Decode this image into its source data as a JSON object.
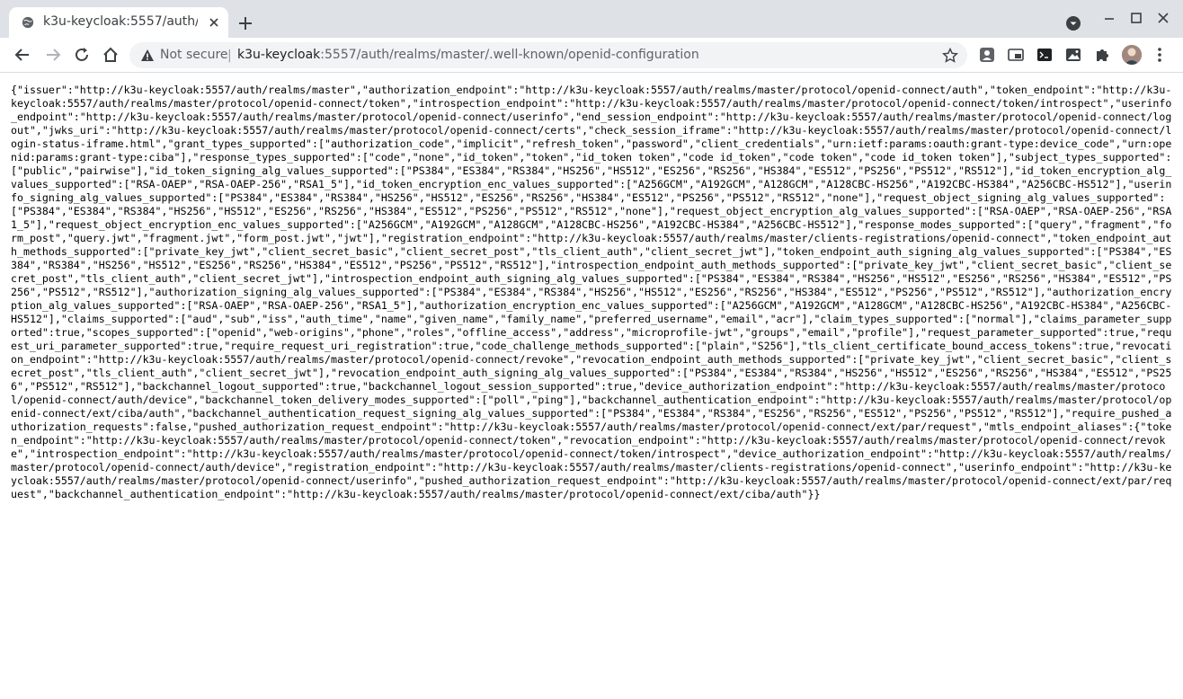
{
  "tab": {
    "title": "k3u-keycloak:5557/auth/r"
  },
  "omnibox": {
    "security_label": "Not secure",
    "separator": "|",
    "url_host": "k3u-keycloak",
    "url_rest": ":5557/auth/realms/master/.well-known/openid-configuration"
  },
  "icons": {
    "favicon": "globe-icon",
    "close": "close-icon",
    "new_tab": "plus-icon",
    "tab_search": "chevron-down-icon",
    "back": "back-arrow-icon",
    "forward": "forward-arrow-icon",
    "reload": "reload-icon",
    "home": "home-icon",
    "warning": "warning-icon",
    "bookmark": "star-icon",
    "menu": "kebab-menu-icon"
  },
  "content": {
    "text": "{\"issuer\":\"http://k3u-keycloak:5557/auth/realms/master\",\"authorization_endpoint\":\"http://k3u-keycloak:5557/auth/realms/master/protocol/openid-connect/auth\",\"token_endpoint\":\"http://k3u-keycloak:5557/auth/realms/master/protocol/openid-connect/token\",\"introspection_endpoint\":\"http://k3u-keycloak:5557/auth/realms/master/protocol/openid-connect/token/introspect\",\"userinfo_endpoint\":\"http://k3u-keycloak:5557/auth/realms/master/protocol/openid-connect/userinfo\",\"end_session_endpoint\":\"http://k3u-keycloak:5557/auth/realms/master/protocol/openid-connect/logout\",\"jwks_uri\":\"http://k3u-keycloak:5557/auth/realms/master/protocol/openid-connect/certs\",\"check_session_iframe\":\"http://k3u-keycloak:5557/auth/realms/master/protocol/openid-connect/login-status-iframe.html\",\"grant_types_supported\":[\"authorization_code\",\"implicit\",\"refresh_token\",\"password\",\"client_credentials\",\"urn:ietf:params:oauth:grant-type:device_code\",\"urn:openid:params:grant-type:ciba\"],\"response_types_supported\":[\"code\",\"none\",\"id_token\",\"token\",\"id_token token\",\"code id_token\",\"code token\",\"code id_token token\"],\"subject_types_supported\":[\"public\",\"pairwise\"],\"id_token_signing_alg_values_supported\":[\"PS384\",\"ES384\",\"RS384\",\"HS256\",\"HS512\",\"ES256\",\"RS256\",\"HS384\",\"ES512\",\"PS256\",\"PS512\",\"RS512\"],\"id_token_encryption_alg_values_supported\":[\"RSA-OAEP\",\"RSA-OAEP-256\",\"RSA1_5\"],\"id_token_encryption_enc_values_supported\":[\"A256GCM\",\"A192GCM\",\"A128GCM\",\"A128CBC-HS256\",\"A192CBC-HS384\",\"A256CBC-HS512\"],\"userinfo_signing_alg_values_supported\":[\"PS384\",\"ES384\",\"RS384\",\"HS256\",\"HS512\",\"ES256\",\"RS256\",\"HS384\",\"ES512\",\"PS256\",\"PS512\",\"RS512\",\"none\"],\"request_object_signing_alg_values_supported\":[\"PS384\",\"ES384\",\"RS384\",\"HS256\",\"HS512\",\"ES256\",\"RS256\",\"HS384\",\"ES512\",\"PS256\",\"PS512\",\"RS512\",\"none\"],\"request_object_encryption_alg_values_supported\":[\"RSA-OAEP\",\"RSA-OAEP-256\",\"RSA1_5\"],\"request_object_encryption_enc_values_supported\":[\"A256GCM\",\"A192GCM\",\"A128GCM\",\"A128CBC-HS256\",\"A192CBC-HS384\",\"A256CBC-HS512\"],\"response_modes_supported\":[\"query\",\"fragment\",\"form_post\",\"query.jwt\",\"fragment.jwt\",\"form_post.jwt\",\"jwt\"],\"registration_endpoint\":\"http://k3u-keycloak:5557/auth/realms/master/clients-registrations/openid-connect\",\"token_endpoint_auth_methods_supported\":[\"private_key_jwt\",\"client_secret_basic\",\"client_secret_post\",\"tls_client_auth\",\"client_secret_jwt\"],\"token_endpoint_auth_signing_alg_values_supported\":[\"PS384\",\"ES384\",\"RS384\",\"HS256\",\"HS512\",\"ES256\",\"RS256\",\"HS384\",\"ES512\",\"PS256\",\"PS512\",\"RS512\"],\"introspection_endpoint_auth_methods_supported\":[\"private_key_jwt\",\"client_secret_basic\",\"client_secret_post\",\"tls_client_auth\",\"client_secret_jwt\"],\"introspection_endpoint_auth_signing_alg_values_supported\":[\"PS384\",\"ES384\",\"RS384\",\"HS256\",\"HS512\",\"ES256\",\"RS256\",\"HS384\",\"ES512\",\"PS256\",\"PS512\",\"RS512\"],\"authorization_signing_alg_values_supported\":[\"PS384\",\"ES384\",\"RS384\",\"HS256\",\"HS512\",\"ES256\",\"RS256\",\"HS384\",\"ES512\",\"PS256\",\"PS512\",\"RS512\"],\"authorization_encryption_alg_values_supported\":[\"RSA-OAEP\",\"RSA-OAEP-256\",\"RSA1_5\"],\"authorization_encryption_enc_values_supported\":[\"A256GCM\",\"A192GCM\",\"A128GCM\",\"A128CBC-HS256\",\"A192CBC-HS384\",\"A256CBC-HS512\"],\"claims_supported\":[\"aud\",\"sub\",\"iss\",\"auth_time\",\"name\",\"given_name\",\"family_name\",\"preferred_username\",\"email\",\"acr\"],\"claim_types_supported\":[\"normal\"],\"claims_parameter_supported\":true,\"scopes_supported\":[\"openid\",\"web-origins\",\"phone\",\"roles\",\"offline_access\",\"address\",\"microprofile-jwt\",\"groups\",\"email\",\"profile\"],\"request_parameter_supported\":true,\"request_uri_parameter_supported\":true,\"require_request_uri_registration\":true,\"code_challenge_methods_supported\":[\"plain\",\"S256\"],\"tls_client_certificate_bound_access_tokens\":true,\"revocation_endpoint\":\"http://k3u-keycloak:5557/auth/realms/master/protocol/openid-connect/revoke\",\"revocation_endpoint_auth_methods_supported\":[\"private_key_jwt\",\"client_secret_basic\",\"client_secret_post\",\"tls_client_auth\",\"client_secret_jwt\"],\"revocation_endpoint_auth_signing_alg_values_supported\":[\"PS384\",\"ES384\",\"RS384\",\"HS256\",\"HS512\",\"ES256\",\"RS256\",\"HS384\",\"ES512\",\"PS256\",\"PS512\",\"RS512\"],\"backchannel_logout_supported\":true,\"backchannel_logout_session_supported\":true,\"device_authorization_endpoint\":\"http://k3u-keycloak:5557/auth/realms/master/protocol/openid-connect/auth/device\",\"backchannel_token_delivery_modes_supported\":[\"poll\",\"ping\"],\"backchannel_authentication_endpoint\":\"http://k3u-keycloak:5557/auth/realms/master/protocol/openid-connect/ext/ciba/auth\",\"backchannel_authentication_request_signing_alg_values_supported\":[\"PS384\",\"ES384\",\"RS384\",\"ES256\",\"RS256\",\"ES512\",\"PS256\",\"PS512\",\"RS512\"],\"require_pushed_authorization_requests\":false,\"pushed_authorization_request_endpoint\":\"http://k3u-keycloak:5557/auth/realms/master/protocol/openid-connect/ext/par/request\",\"mtls_endpoint_aliases\":{\"token_endpoint\":\"http://k3u-keycloak:5557/auth/realms/master/protocol/openid-connect/token\",\"revocation_endpoint\":\"http://k3u-keycloak:5557/auth/realms/master/protocol/openid-connect/revoke\",\"introspection_endpoint\":\"http://k3u-keycloak:5557/auth/realms/master/protocol/openid-connect/token/introspect\",\"device_authorization_endpoint\":\"http://k3u-keycloak:5557/auth/realms/master/protocol/openid-connect/auth/device\",\"registration_endpoint\":\"http://k3u-keycloak:5557/auth/realms/master/clients-registrations/openid-connect\",\"userinfo_endpoint\":\"http://k3u-keycloak:5557/auth/realms/master/protocol/openid-connect/userinfo\",\"pushed_authorization_request_endpoint\":\"http://k3u-keycloak:5557/auth/realms/master/protocol/openid-connect/ext/par/request\",\"backchannel_authentication_endpoint\":\"http://k3u-keycloak:5557/auth/realms/master/protocol/openid-connect/ext/ciba/auth\"}}"
  },
  "colors": {
    "tabstrip": "#dee1e6",
    "omnibox": "#f1f3f4",
    "text": "#000000"
  }
}
